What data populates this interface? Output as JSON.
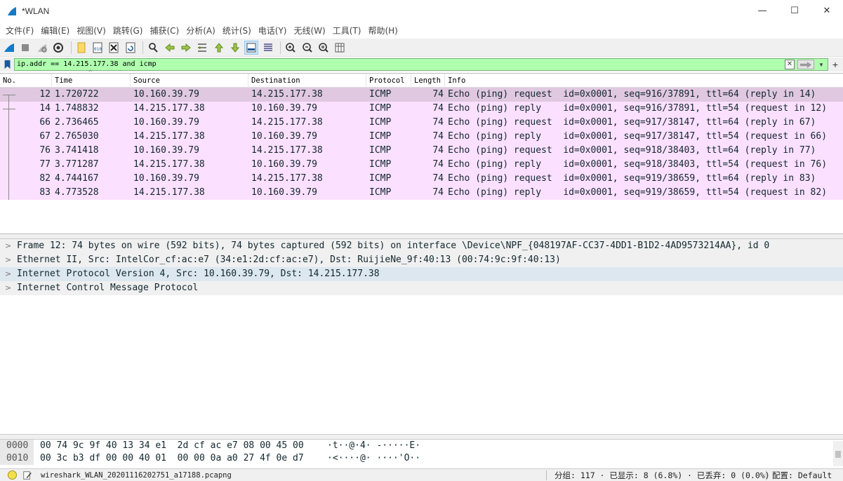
{
  "window": {
    "title": "*WLAN",
    "minimize": "—",
    "maximize": "☐",
    "close": "✕"
  },
  "menu": [
    "文件(F)",
    "编辑(E)",
    "视图(V)",
    "跳转(G)",
    "捕获(C)",
    "分析(A)",
    "统计(S)",
    "电话(Y)",
    "无线(W)",
    "工具(T)",
    "帮助(H)"
  ],
  "filter": {
    "value": "ip.addr == 14.215.177.38 and icmp",
    "add_label": "+"
  },
  "columns": {
    "no": "No.",
    "time": "Time",
    "source": "Source",
    "destination": "Destination",
    "protocol": "Protocol",
    "length": "Length",
    "info": "Info",
    "sort_indicator": "^"
  },
  "packets": [
    {
      "no": "12",
      "time": "1.720722",
      "src": "10.160.39.79",
      "dst": "14.215.177.38",
      "proto": "ICMP",
      "len": "74",
      "info": "Echo (ping) request  id=0x0001, seq=916/37891, ttl=64 (reply in 14)"
    },
    {
      "no": "14",
      "time": "1.748832",
      "src": "14.215.177.38",
      "dst": "10.160.39.79",
      "proto": "ICMP",
      "len": "74",
      "info": "Echo (ping) reply    id=0x0001, seq=916/37891, ttl=54 (request in 12)"
    },
    {
      "no": "66",
      "time": "2.736465",
      "src": "10.160.39.79",
      "dst": "14.215.177.38",
      "proto": "ICMP",
      "len": "74",
      "info": "Echo (ping) request  id=0x0001, seq=917/38147, ttl=64 (reply in 67)"
    },
    {
      "no": "67",
      "time": "2.765030",
      "src": "14.215.177.38",
      "dst": "10.160.39.79",
      "proto": "ICMP",
      "len": "74",
      "info": "Echo (ping) reply    id=0x0001, seq=917/38147, ttl=54 (request in 66)"
    },
    {
      "no": "76",
      "time": "3.741418",
      "src": "10.160.39.79",
      "dst": "14.215.177.38",
      "proto": "ICMP",
      "len": "74",
      "info": "Echo (ping) request  id=0x0001, seq=918/38403, ttl=64 (reply in 77)"
    },
    {
      "no": "77",
      "time": "3.771287",
      "src": "14.215.177.38",
      "dst": "10.160.39.79",
      "proto": "ICMP",
      "len": "74",
      "info": "Echo (ping) reply    id=0x0001, seq=918/38403, ttl=54 (request in 76)"
    },
    {
      "no": "82",
      "time": "4.744167",
      "src": "10.160.39.79",
      "dst": "14.215.177.38",
      "proto": "ICMP",
      "len": "74",
      "info": "Echo (ping) request  id=0x0001, seq=919/38659, ttl=64 (reply in 83)"
    },
    {
      "no": "83",
      "time": "4.773528",
      "src": "14.215.177.38",
      "dst": "10.160.39.79",
      "proto": "ICMP",
      "len": "74",
      "info": "Echo (ping) reply    id=0x0001, seq=919/38659, ttl=54 (request in 82)"
    }
  ],
  "details": [
    "Frame 12: 74 bytes on wire (592 bits), 74 bytes captured (592 bits) on interface \\Device\\NPF_{048197AF-CC37-4DD1-B1D2-4AD9573214AA}, id 0",
    "Ethernet II, Src: IntelCor_cf:ac:e7 (34:e1:2d:cf:ac:e7), Dst: RuijieNe_9f:40:13 (00:74:9c:9f:40:13)",
    "Internet Protocol Version 4, Src: 10.160.39.79, Dst: 14.215.177.38",
    "Internet Control Message Protocol"
  ],
  "bytes": [
    {
      "offset": "0000",
      "hex": "00 74 9c 9f 40 13 34 e1  2d cf ac e7 08 00 45 00",
      "ascii": "·t··@·4· -·····E·"
    },
    {
      "offset": "0010",
      "hex": "00 3c b3 df 00 00 40 01  00 00 0a a0 27 4f 0e d7",
      "ascii": "·<····@· ····'O··"
    }
  ],
  "status": {
    "file": "wireshark_WLAN_20201116202751_a17188.pcapng",
    "stats": "分组: 117 · 已显示: 8 (6.8%) · 已丢弃: 0 (0.0%)",
    "profile": "配置: Default"
  },
  "colors": {
    "selected_row": "#e0c8e0",
    "icmp_row": "#fce0ff",
    "filter_valid": "#afffaf"
  }
}
